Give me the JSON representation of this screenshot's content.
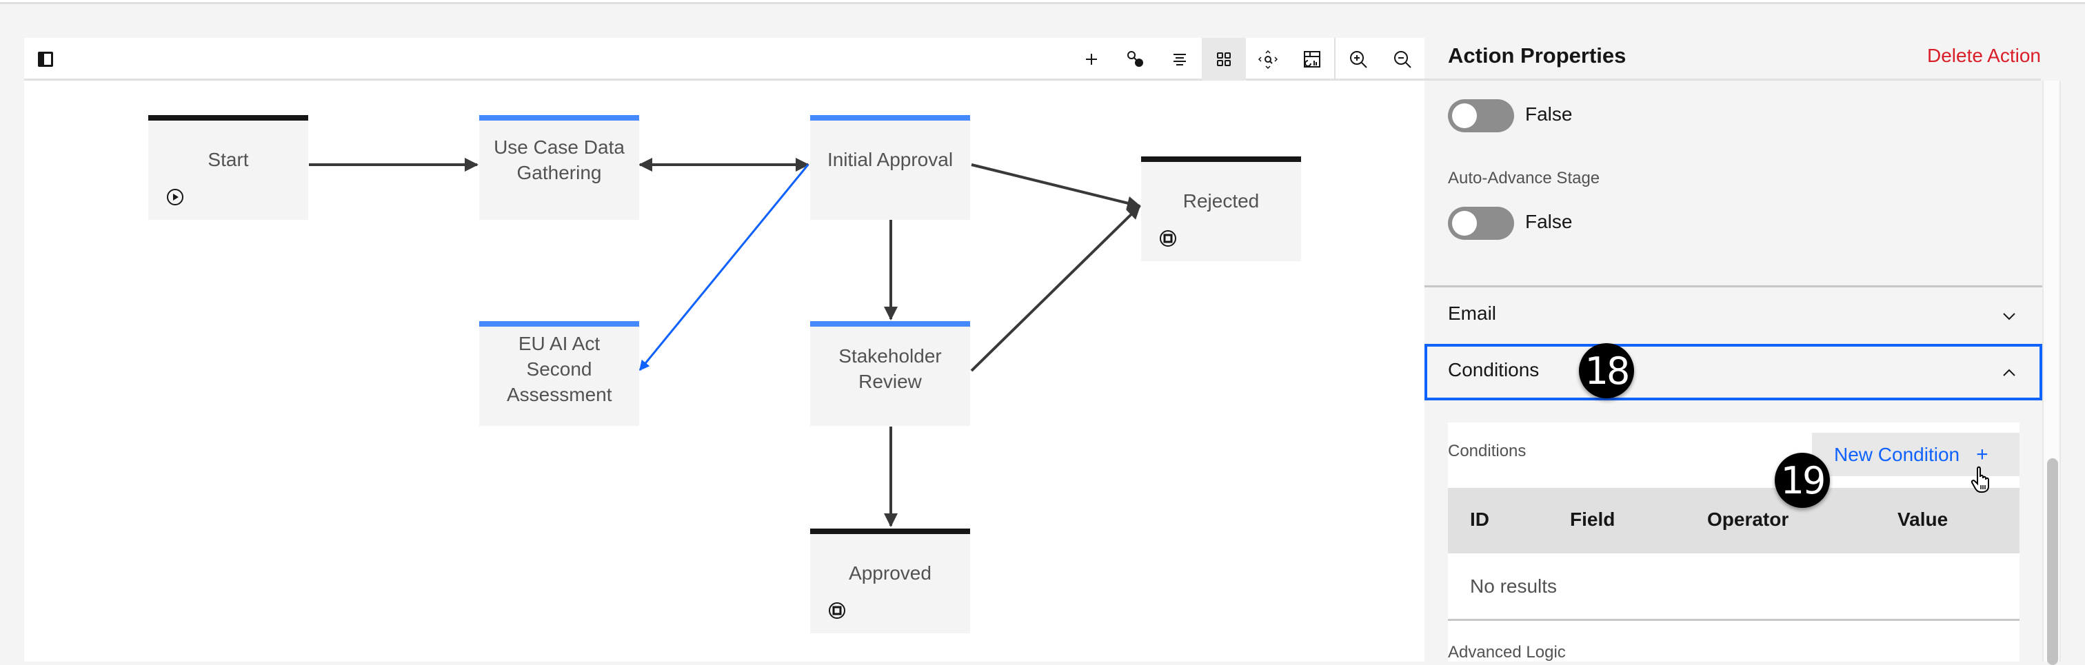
{
  "canvas": {
    "toolbar": {
      "items": [
        {
          "name": "add",
          "icon": "plus-icon"
        },
        {
          "name": "connect",
          "icon": "connect-nodes-icon"
        },
        {
          "name": "align",
          "icon": "align-center-icon"
        },
        {
          "name": "grid",
          "icon": "grid-icon",
          "active": true
        },
        {
          "name": "fit",
          "icon": "fit-to-screen-icon"
        },
        {
          "name": "minimap",
          "icon": "minimap-icon"
        },
        {
          "name": "zoom-in",
          "icon": "zoom-in-icon"
        },
        {
          "name": "zoom-out",
          "icon": "zoom-out-icon"
        }
      ]
    },
    "nodes": [
      {
        "id": "start",
        "label": "Start",
        "type": "terminal",
        "icon": "play-icon"
      },
      {
        "id": "use-case",
        "label": "Use Case Data Gathering",
        "type": "stage"
      },
      {
        "id": "initial-approval",
        "label": "Initial Approval",
        "type": "stage"
      },
      {
        "id": "rejected",
        "label": "Rejected",
        "type": "terminal",
        "icon": "stop-icon"
      },
      {
        "id": "eu-ai-act",
        "label": "EU AI Act Second Assessment",
        "type": "stage"
      },
      {
        "id": "stakeholder",
        "label": "Stakeholder Review",
        "type": "stage"
      },
      {
        "id": "approved",
        "label": "Approved",
        "type": "terminal",
        "icon": "stop-icon"
      }
    ],
    "edges": [
      {
        "from": "start",
        "to": "use-case"
      },
      {
        "from": "use-case",
        "to": "initial-approval",
        "bidirectional": true
      },
      {
        "from": "initial-approval",
        "to": "eu-ai-act",
        "selected": true
      },
      {
        "from": "initial-approval",
        "to": "stakeholder"
      },
      {
        "from": "initial-approval",
        "to": "rejected"
      },
      {
        "from": "stakeholder",
        "to": "rejected"
      },
      {
        "from": "stakeholder",
        "to": "approved"
      }
    ]
  },
  "panel": {
    "title": "Action Properties",
    "delete_label": "Delete Action",
    "toggle1": {
      "value": "False",
      "on": false
    },
    "auto_advance": {
      "label": "Auto-Advance Stage",
      "value": "False",
      "on": false
    },
    "accordions": [
      {
        "title": "Email",
        "expanded": false
      },
      {
        "title": "Conditions",
        "expanded": true
      }
    ],
    "conditions": {
      "label": "Conditions",
      "new_button": "New Condition",
      "new_button_icon": "+",
      "columns": [
        "ID",
        "Field",
        "Operator",
        "Value"
      ],
      "empty_text": "No results"
    },
    "advanced_logic_label": "Advanced Logic"
  },
  "annotations": [
    "18",
    "19"
  ],
  "colors": {
    "accent": "#0f62fe",
    "stage_bar": "#4589ff",
    "danger": "#da1e28",
    "edge": "#393939"
  }
}
